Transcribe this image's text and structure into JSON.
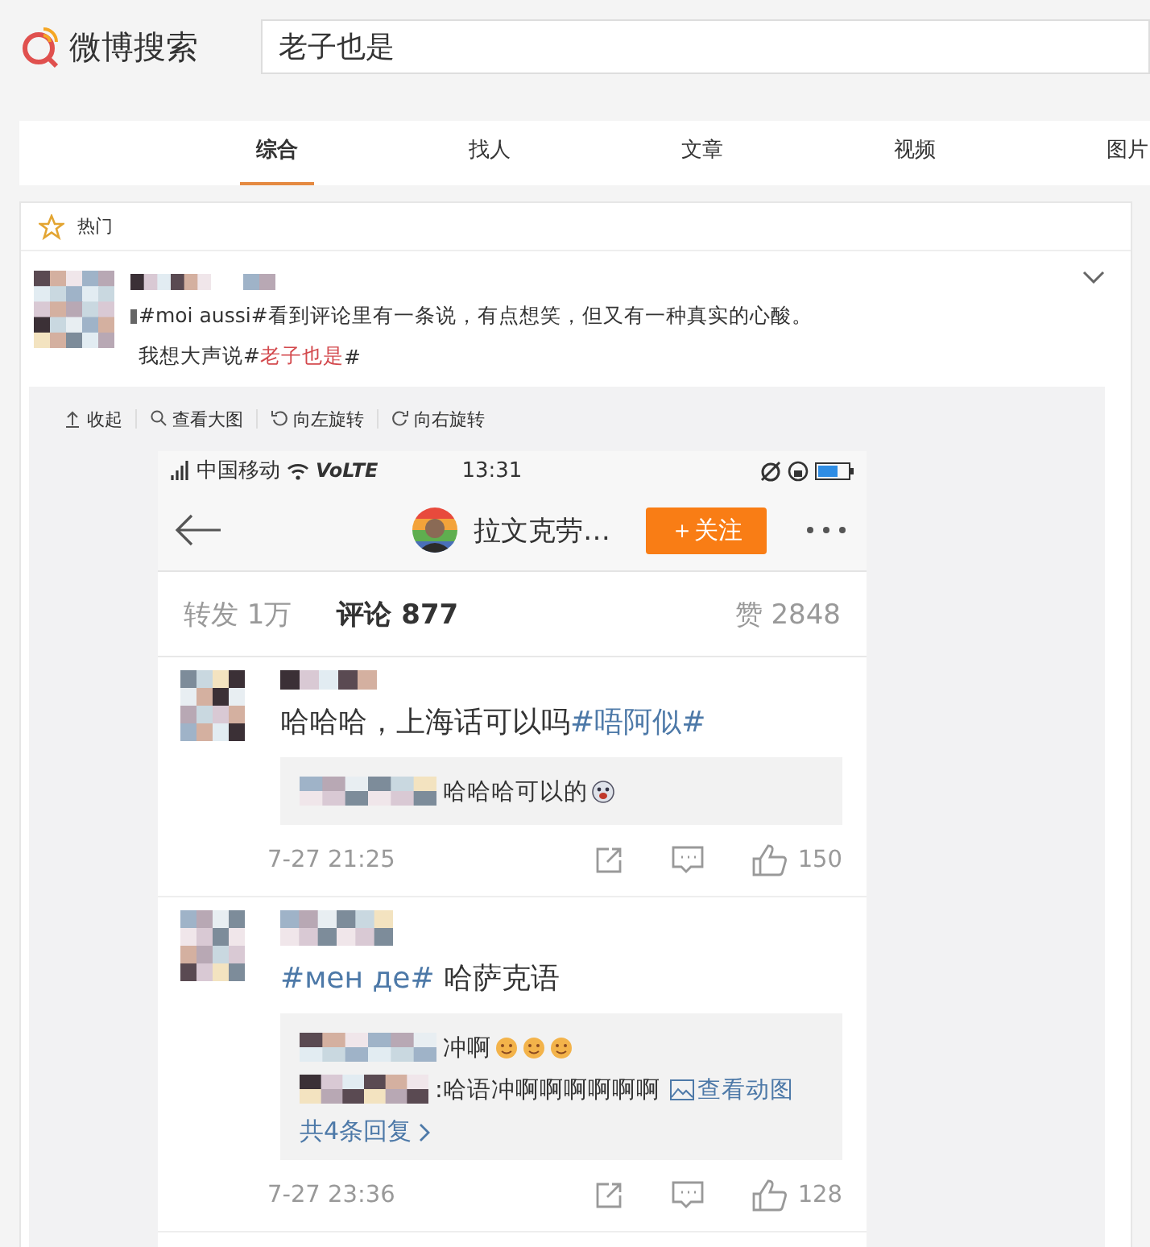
{
  "header": {
    "logo": "微博搜索",
    "search": {
      "value": "老子也是"
    }
  },
  "tabs": [
    {
      "label": "综合",
      "selected": true
    },
    {
      "label": "找人",
      "selected": false
    },
    {
      "label": "文章",
      "selected": false
    },
    {
      "label": "视频",
      "selected": false
    },
    {
      "label": "图片",
      "selected": false
    }
  ],
  "section": {
    "title": "热门"
  },
  "post": {
    "lines": [
      [
        {
          "kind": "plain",
          "text": "#moi aussi#看到评论里有一条说，有点想笑，但又有一种真实的心酸。"
        }
      ],
      [
        {
          "kind": "plain",
          "text": "我想大声说#"
        },
        {
          "kind": "topic",
          "text": "老子也是"
        },
        {
          "kind": "plain",
          "text": "#"
        }
      ]
    ],
    "image_toolbar": [
      "收起",
      "查看大图",
      "向左旋转",
      "向右旋转"
    ],
    "screenshot": {
      "status": {
        "carrier": "中国移动",
        "network": "VoLTE",
        "time": "13:31"
      },
      "nav": {
        "name": "拉文克劳…",
        "follow": "＋关注"
      },
      "stats": [
        {
          "label": "转发 1万",
          "selected": false
        },
        {
          "label": "评论 877",
          "selected": true
        },
        {
          "label": "赞 2848",
          "selected": false
        }
      ],
      "comments": [
        {
          "text": [
            {
              "kind": "plain",
              "text": "哈哈哈，上海话可以吗"
            },
            {
              "kind": "topic",
              "text": "#唔阿似#"
            }
          ],
          "replies": [
            {
              "text": "哈哈哈可以的",
              "emojis": [
                {
                  "kind": "grin"
                }
              ]
            }
          ],
          "time": "7-27 21:25",
          "likes": "150"
        },
        {
          "text": [
            {
              "kind": "topic",
              "text": "#мен де#"
            },
            {
              "kind": "plain",
              "text": " 哈萨克语"
            }
          ],
          "replies": [
            {
              "text": "冲啊",
              "emojis": [
                {
                  "kind": "smile"
                },
                {
                  "kind": "smile"
                },
                {
                  "kind": "smile"
                }
              ]
            },
            {
              "text": ":哈语冲啊啊啊啊啊啊",
              "link": "查看动图"
            }
          ],
          "more": "共4条回复",
          "time": "7-27 23:36",
          "likes": "128"
        }
      ]
    }
  }
}
